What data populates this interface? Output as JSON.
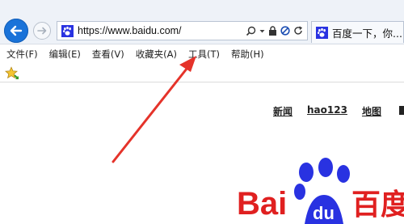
{
  "browser": {
    "address": {
      "url": "https://www.baidu.com/"
    },
    "tab": {
      "label": "百度一下，你..."
    },
    "menu": [
      {
        "label": "文件(F)"
      },
      {
        "label": "编辑(E)"
      },
      {
        "label": "查看(V)"
      },
      {
        "label": "收藏夹(A)"
      },
      {
        "label": "工具(T)"
      },
      {
        "label": "帮助(H)"
      }
    ]
  },
  "page": {
    "links": [
      {
        "label": "新闻"
      },
      {
        "label": "hao123"
      },
      {
        "label": "地图"
      }
    ],
    "logo": {
      "text_left": "Bai",
      "text_mid": "du",
      "text_right": "百度"
    }
  },
  "colors": {
    "accent": "#1a73d9",
    "baidu_red": "#e02020",
    "baidu_blue": "#2932e1",
    "annotation_arrow": "#e5332a"
  },
  "icons": [
    "back-arrow-icon",
    "forward-arrow-icon",
    "paw-favicon-icon",
    "search-icon",
    "dropdown-icon",
    "lock-icon",
    "block-icon",
    "refresh-icon",
    "favorites-star-icon"
  ]
}
